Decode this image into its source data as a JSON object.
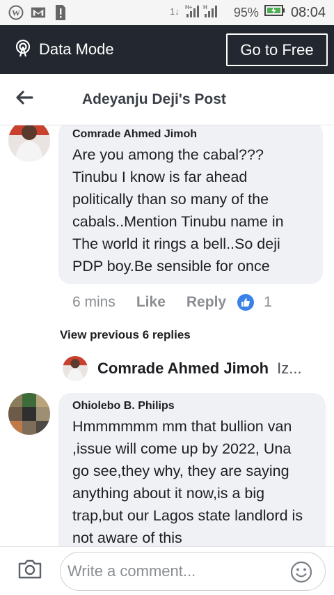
{
  "status_bar": {
    "signal_text": "1↓ H+ H",
    "battery_pct": "95%",
    "time": "08:04"
  },
  "data_banner": {
    "label": "Data Mode",
    "button_label": "Go to Free"
  },
  "header": {
    "title": "Adeyanju Deji's Post"
  },
  "comment1": {
    "author": "Comrade Ahmed Jimoh",
    "text": "Are you among the cabal??? Tinubu I know is far ahead politically than so many of the cabals..Mention Tinubu name in The world it rings a bell..So deji PDP boy.Be sensible for once",
    "time": "6 mins",
    "like_label": "Like",
    "reply_label": "Reply",
    "like_count": "1"
  },
  "replies": {
    "view_previous": "View previous 6 replies",
    "latest_author": "Comrade Ahmed Jimoh",
    "latest_snippet": "Iz..."
  },
  "comment2": {
    "author": "Ohiolebo B. Philips",
    "text": "Hmmmmmm mm that bullion van ,issue will come up by 2022, Una go see,they why, they are saying anything about it now,is a big trap,but our Lagos state landlord is not aware of this"
  },
  "composer": {
    "placeholder": "Write a comment..."
  },
  "colors": {
    "banner_bg": "#23272f",
    "bubble_bg": "#f0f1f5",
    "like_blue": "#3b82e8",
    "battery_green": "#4caf50"
  },
  "icons": [
    "wordpress-icon",
    "gmail-icon",
    "sim-alert-icon",
    "signal-icon",
    "battery-icon",
    "data-mode-icon",
    "back-arrow-icon",
    "like-thumb-icon",
    "camera-icon",
    "emoji-icon"
  ]
}
